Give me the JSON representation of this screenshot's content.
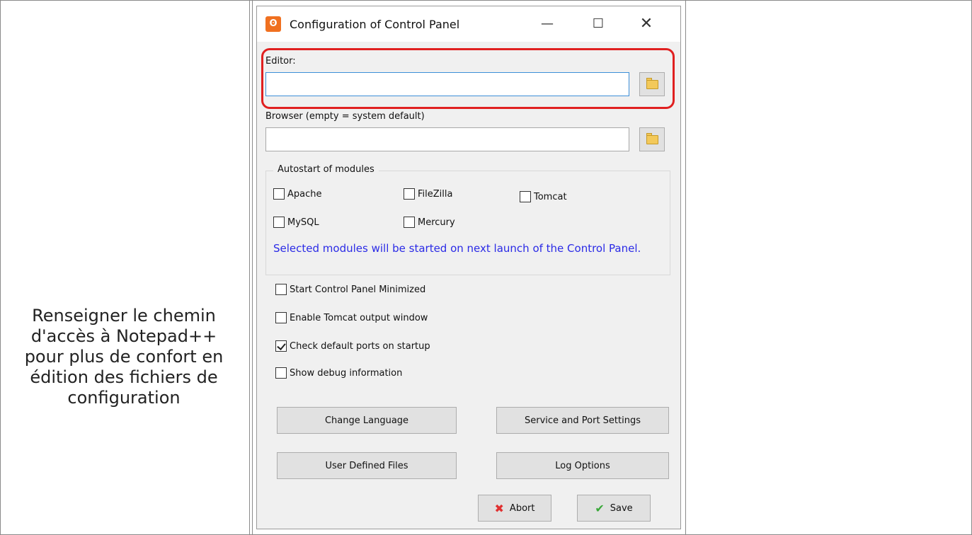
{
  "caption": "Renseigner le chemin d'accès à Notepad++ pour plus de confort en édition des fichiers de configuration",
  "window": {
    "title": "Configuration of Control Panel",
    "icon": "xampp-logo-icon",
    "controls": {
      "minimize": "—",
      "maximize": "☐",
      "close": "✕"
    }
  },
  "editor": {
    "label": "Editor:",
    "value": ""
  },
  "browser": {
    "label": "Browser (empty = system default)",
    "value": ""
  },
  "autostart": {
    "title": "Autostart of modules",
    "modules": [
      {
        "label": "Apache",
        "checked": false
      },
      {
        "label": "FileZilla",
        "checked": false
      },
      {
        "label": "Tomcat",
        "checked": false
      },
      {
        "label": "MySQL",
        "checked": false
      },
      {
        "label": "Mercury",
        "checked": false
      }
    ],
    "info": "Selected modules will be started on next launch of the Control Panel."
  },
  "options": [
    {
      "label": "Start Control Panel Minimized",
      "checked": false
    },
    {
      "label": "Enable Tomcat output window",
      "checked": false
    },
    {
      "label": "Check default ports on startup",
      "checked": true
    },
    {
      "label": "Show debug information",
      "checked": false
    }
  ],
  "buttons": {
    "change_language": "Change Language",
    "service_port": "Service and Port Settings",
    "user_defined": "User Defined Files",
    "log_options": "Log Options",
    "abort": "Abort",
    "save": "Save"
  },
  "colors": {
    "highlight": "#e02020",
    "info_text": "#2a2ae6",
    "icon_orange": "#f07020"
  }
}
